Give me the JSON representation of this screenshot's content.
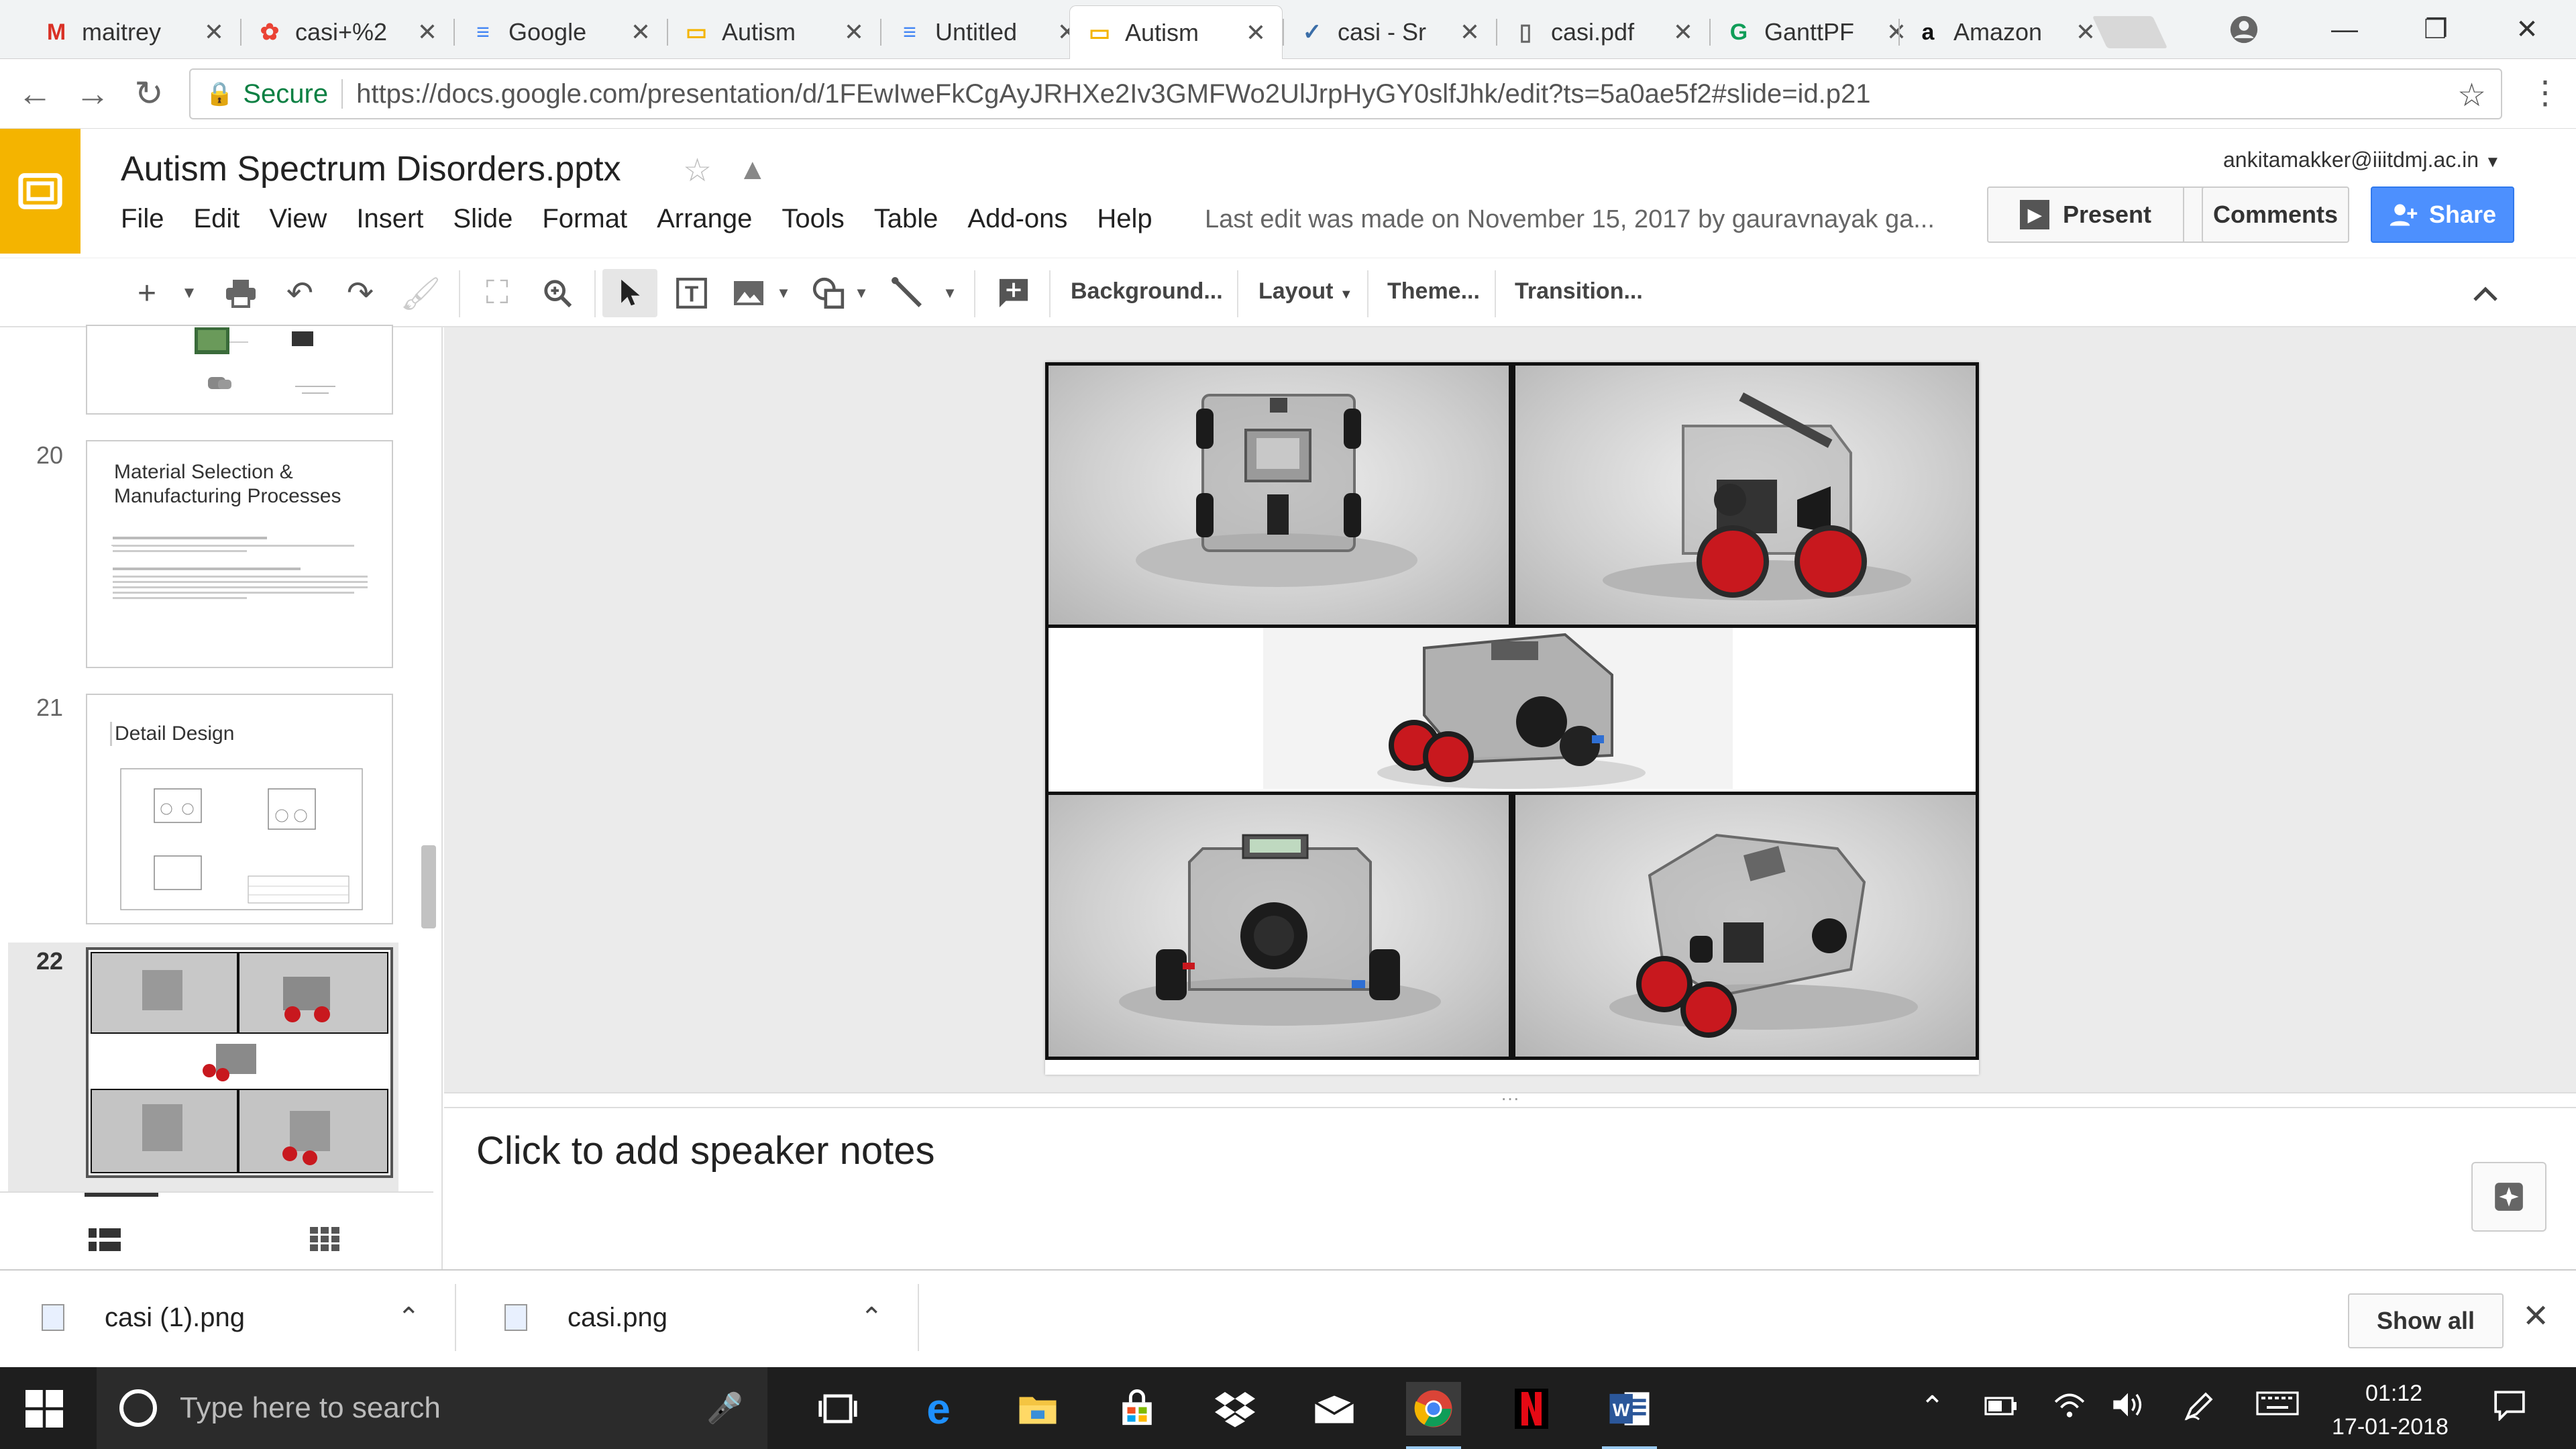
{
  "browser": {
    "tabs": [
      {
        "label": "maitrey",
        "icon": "gmail-icon",
        "fav_text": "M",
        "fav_color": "#d93025"
      },
      {
        "label": "casi+%2",
        "icon": "google-photos-icon",
        "fav_text": "✿",
        "fav_color": "#ea4335"
      },
      {
        "label": "Google",
        "icon": "google-docs-icon",
        "fav_text": "≡",
        "fav_color": "#4285f4"
      },
      {
        "label": "Autism",
        "icon": "google-slides-icon",
        "fav_text": "▭",
        "fav_color": "#f4b400"
      },
      {
        "label": "Untitled",
        "icon": "google-docs-icon",
        "fav_text": "≡",
        "fav_color": "#4285f4"
      },
      {
        "label": "Autism",
        "icon": "google-slides-icon",
        "fav_text": "▭",
        "fav_color": "#f4b400"
      },
      {
        "label": "casi - Sr",
        "icon": "check-icon",
        "fav_text": "✓",
        "fav_color": "#3b6ea8"
      },
      {
        "label": "casi.pdf",
        "icon": "file-icon",
        "fav_text": "▯",
        "fav_color": "#666666"
      },
      {
        "label": "GanttPF",
        "icon": "gantt-icon",
        "fav_text": "G",
        "fav_color": "#0f9d58"
      },
      {
        "label": "Amazon",
        "icon": "amazon-icon",
        "fav_text": "a",
        "fav_color": "#111111"
      }
    ],
    "active_tab_index": 5,
    "secure_label": "Secure",
    "url": "https://docs.google.com/presentation/d/1FEwIweFkCgAyJRHXe2Iv3GMFWo2UlJrpHyGY0slfJhk/edit?ts=5a0ae5f2#slide=id.p21"
  },
  "doc": {
    "title": "Autism Spectrum Disorders.pptx",
    "account": "ankitamakker@iiitdmj.ac.in",
    "menu": [
      "File",
      "Edit",
      "View",
      "Insert",
      "Slide",
      "Format",
      "Arrange",
      "Tools",
      "Table",
      "Add-ons",
      "Help"
    ],
    "last_edit": "Last edit was made on November 15, 2017 by gauravnayak ga...",
    "present_label": "Present",
    "comments_label": "Comments",
    "share_label": "Share"
  },
  "toolbar": {
    "background_label": "Background...",
    "layout_label": "Layout",
    "theme_label": "Theme...",
    "transition_label": "Transition..."
  },
  "filmstrip": {
    "slides": [
      {
        "number": "20",
        "title": "Material Selection & Manufacturing Processes"
      },
      {
        "number": "21",
        "title": "Detail Design"
      },
      {
        "number": "22",
        "title": ""
      }
    ],
    "selected": "22"
  },
  "notes": {
    "placeholder": "Click to add speaker notes"
  },
  "downloads": {
    "items": [
      "casi (1).png",
      "casi.png"
    ],
    "show_all_label": "Show all"
  },
  "taskbar": {
    "search_placeholder": "Type here to search",
    "time": "01:12",
    "date": "17-01-2018"
  },
  "colors": {
    "slides_accent": "#f4b400",
    "share_blue": "#4d90fe",
    "secure_green": "#0b8043",
    "wheel_red": "#c8181e"
  }
}
